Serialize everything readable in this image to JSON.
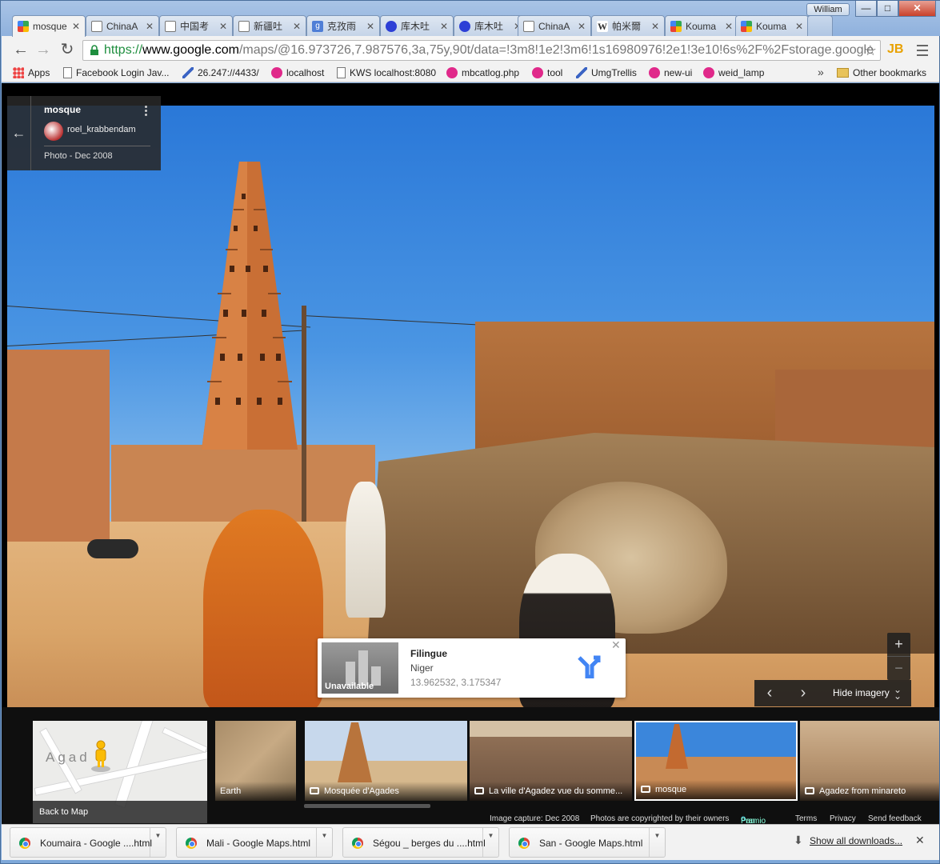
{
  "window": {
    "user": "William",
    "controls": {
      "minimize": "—",
      "maximize": "□",
      "close": "✕"
    }
  },
  "tabs": [
    {
      "label": "mosque",
      "icon": "google-maps-icon",
      "active": true
    },
    {
      "label": "ChinaA",
      "icon": "page-icon"
    },
    {
      "label": "中国考",
      "icon": "page-icon"
    },
    {
      "label": "新疆吐",
      "icon": "page-icon"
    },
    {
      "label": "克孜雨",
      "icon": "google-icon"
    },
    {
      "label": "库木吐",
      "icon": "baidu-icon"
    },
    {
      "label": "库木吐",
      "icon": "baidu-icon"
    },
    {
      "label": "ChinaA",
      "icon": "page-icon"
    },
    {
      "label": "帕米爾",
      "icon": "wikipedia-icon"
    },
    {
      "label": "Kouma",
      "icon": "google-maps-icon"
    },
    {
      "label": "Kouma",
      "icon": "google-maps-icon"
    }
  ],
  "omnibox": {
    "scheme": "https://",
    "host": "www.google.com",
    "path": "/maps/@16.973726,7.987576,3a,75y,90t/data=!3m8!1e2!3m6!1s16980976!2e1!3e10!6s%2F%2Fstorage.google"
  },
  "extension_label": "JB",
  "bookmarks": [
    {
      "label": "Apps",
      "icon": "apps-grid-icon"
    },
    {
      "label": "Facebook Login Jav...",
      "icon": "page-icon"
    },
    {
      "label": "26.247://4433/",
      "icon": "umg-icon"
    },
    {
      "label": "localhost",
      "icon": "m-icon"
    },
    {
      "label": "KWS localhost:8080",
      "icon": "page-icon"
    },
    {
      "label": "mbcatlog.php",
      "icon": "m-icon"
    },
    {
      "label": "tool",
      "icon": "m-icon"
    },
    {
      "label": "UmgTrellis",
      "icon": "umg-icon"
    },
    {
      "label": "new-ui",
      "icon": "m-icon"
    },
    {
      "label": "weid_lamp",
      "icon": "m-icon"
    }
  ],
  "bookmarks_more": "»",
  "other_bookmarks": "Other bookmarks",
  "photo_info": {
    "title": "mosque",
    "author": "roel_krabbendam",
    "date": "Photo - Dec 2008"
  },
  "location_card": {
    "thumbnail_text": "Unavailable",
    "name": "Filingue",
    "country": "Niger",
    "coordinates": "13.962532, 3.175347"
  },
  "imagery": {
    "hide_label": "Hide imagery"
  },
  "filmstrip": {
    "map_town": "Agad",
    "back_to_map": "Back to Map",
    "items": [
      {
        "label": "Earth",
        "camera": false
      },
      {
        "label": "Mosquée d'Agades",
        "camera": true
      },
      {
        "label": "La ville d'Agadez vue du somme...",
        "camera": true
      },
      {
        "label": "mosque",
        "camera": true,
        "selected": true
      },
      {
        "label": "Agadez from minareto",
        "camera": true
      }
    ]
  },
  "footer": {
    "capture": "Image capture: Dec 2008",
    "copyright": "Photos are copyrighted by their owners",
    "panoramio_a": "Pan",
    "panoramio_b": "o",
    "panoramio_c": "ramio",
    "terms": "Terms",
    "privacy": "Privacy",
    "feedback": "Send feedback"
  },
  "downloads": {
    "items": [
      {
        "label": "Koumaira - Google ....html"
      },
      {
        "label": "Mali - Google Maps.html"
      },
      {
        "label": "Ségou _ berges du ....html"
      },
      {
        "label": "San - Google Maps.html"
      }
    ],
    "show_all": "Show all downloads..."
  },
  "colors": {
    "accent_blue": "#4285f4",
    "https_green": "#1e8e3e",
    "maps_dark": "#282828"
  }
}
